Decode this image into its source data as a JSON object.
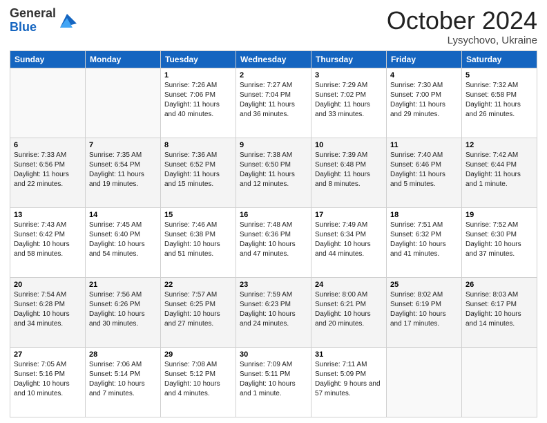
{
  "header": {
    "logo_line1": "General",
    "logo_line2": "Blue",
    "month": "October 2024",
    "location": "Lysychovo, Ukraine"
  },
  "days_of_week": [
    "Sunday",
    "Monday",
    "Tuesday",
    "Wednesday",
    "Thursday",
    "Friday",
    "Saturday"
  ],
  "weeks": [
    [
      {
        "day": "",
        "sunrise": "",
        "sunset": "",
        "daylight": ""
      },
      {
        "day": "",
        "sunrise": "",
        "sunset": "",
        "daylight": ""
      },
      {
        "day": "1",
        "sunrise": "Sunrise: 7:26 AM",
        "sunset": "Sunset: 7:06 PM",
        "daylight": "Daylight: 11 hours and 40 minutes."
      },
      {
        "day": "2",
        "sunrise": "Sunrise: 7:27 AM",
        "sunset": "Sunset: 7:04 PM",
        "daylight": "Daylight: 11 hours and 36 minutes."
      },
      {
        "day": "3",
        "sunrise": "Sunrise: 7:29 AM",
        "sunset": "Sunset: 7:02 PM",
        "daylight": "Daylight: 11 hours and 33 minutes."
      },
      {
        "day": "4",
        "sunrise": "Sunrise: 7:30 AM",
        "sunset": "Sunset: 7:00 PM",
        "daylight": "Daylight: 11 hours and 29 minutes."
      },
      {
        "day": "5",
        "sunrise": "Sunrise: 7:32 AM",
        "sunset": "Sunset: 6:58 PM",
        "daylight": "Daylight: 11 hours and 26 minutes."
      }
    ],
    [
      {
        "day": "6",
        "sunrise": "Sunrise: 7:33 AM",
        "sunset": "Sunset: 6:56 PM",
        "daylight": "Daylight: 11 hours and 22 minutes."
      },
      {
        "day": "7",
        "sunrise": "Sunrise: 7:35 AM",
        "sunset": "Sunset: 6:54 PM",
        "daylight": "Daylight: 11 hours and 19 minutes."
      },
      {
        "day": "8",
        "sunrise": "Sunrise: 7:36 AM",
        "sunset": "Sunset: 6:52 PM",
        "daylight": "Daylight: 11 hours and 15 minutes."
      },
      {
        "day": "9",
        "sunrise": "Sunrise: 7:38 AM",
        "sunset": "Sunset: 6:50 PM",
        "daylight": "Daylight: 11 hours and 12 minutes."
      },
      {
        "day": "10",
        "sunrise": "Sunrise: 7:39 AM",
        "sunset": "Sunset: 6:48 PM",
        "daylight": "Daylight: 11 hours and 8 minutes."
      },
      {
        "day": "11",
        "sunrise": "Sunrise: 7:40 AM",
        "sunset": "Sunset: 6:46 PM",
        "daylight": "Daylight: 11 hours and 5 minutes."
      },
      {
        "day": "12",
        "sunrise": "Sunrise: 7:42 AM",
        "sunset": "Sunset: 6:44 PM",
        "daylight": "Daylight: 11 hours and 1 minute."
      }
    ],
    [
      {
        "day": "13",
        "sunrise": "Sunrise: 7:43 AM",
        "sunset": "Sunset: 6:42 PM",
        "daylight": "Daylight: 10 hours and 58 minutes."
      },
      {
        "day": "14",
        "sunrise": "Sunrise: 7:45 AM",
        "sunset": "Sunset: 6:40 PM",
        "daylight": "Daylight: 10 hours and 54 minutes."
      },
      {
        "day": "15",
        "sunrise": "Sunrise: 7:46 AM",
        "sunset": "Sunset: 6:38 PM",
        "daylight": "Daylight: 10 hours and 51 minutes."
      },
      {
        "day": "16",
        "sunrise": "Sunrise: 7:48 AM",
        "sunset": "Sunset: 6:36 PM",
        "daylight": "Daylight: 10 hours and 47 minutes."
      },
      {
        "day": "17",
        "sunrise": "Sunrise: 7:49 AM",
        "sunset": "Sunset: 6:34 PM",
        "daylight": "Daylight: 10 hours and 44 minutes."
      },
      {
        "day": "18",
        "sunrise": "Sunrise: 7:51 AM",
        "sunset": "Sunset: 6:32 PM",
        "daylight": "Daylight: 10 hours and 41 minutes."
      },
      {
        "day": "19",
        "sunrise": "Sunrise: 7:52 AM",
        "sunset": "Sunset: 6:30 PM",
        "daylight": "Daylight: 10 hours and 37 minutes."
      }
    ],
    [
      {
        "day": "20",
        "sunrise": "Sunrise: 7:54 AM",
        "sunset": "Sunset: 6:28 PM",
        "daylight": "Daylight: 10 hours and 34 minutes."
      },
      {
        "day": "21",
        "sunrise": "Sunrise: 7:56 AM",
        "sunset": "Sunset: 6:26 PM",
        "daylight": "Daylight: 10 hours and 30 minutes."
      },
      {
        "day": "22",
        "sunrise": "Sunrise: 7:57 AM",
        "sunset": "Sunset: 6:25 PM",
        "daylight": "Daylight: 10 hours and 27 minutes."
      },
      {
        "day": "23",
        "sunrise": "Sunrise: 7:59 AM",
        "sunset": "Sunset: 6:23 PM",
        "daylight": "Daylight: 10 hours and 24 minutes."
      },
      {
        "day": "24",
        "sunrise": "Sunrise: 8:00 AM",
        "sunset": "Sunset: 6:21 PM",
        "daylight": "Daylight: 10 hours and 20 minutes."
      },
      {
        "day": "25",
        "sunrise": "Sunrise: 8:02 AM",
        "sunset": "Sunset: 6:19 PM",
        "daylight": "Daylight: 10 hours and 17 minutes."
      },
      {
        "day": "26",
        "sunrise": "Sunrise: 8:03 AM",
        "sunset": "Sunset: 6:17 PM",
        "daylight": "Daylight: 10 hours and 14 minutes."
      }
    ],
    [
      {
        "day": "27",
        "sunrise": "Sunrise: 7:05 AM",
        "sunset": "Sunset: 5:16 PM",
        "daylight": "Daylight: 10 hours and 10 minutes."
      },
      {
        "day": "28",
        "sunrise": "Sunrise: 7:06 AM",
        "sunset": "Sunset: 5:14 PM",
        "daylight": "Daylight: 10 hours and 7 minutes."
      },
      {
        "day": "29",
        "sunrise": "Sunrise: 7:08 AM",
        "sunset": "Sunset: 5:12 PM",
        "daylight": "Daylight: 10 hours and 4 minutes."
      },
      {
        "day": "30",
        "sunrise": "Sunrise: 7:09 AM",
        "sunset": "Sunset: 5:11 PM",
        "daylight": "Daylight: 10 hours and 1 minute."
      },
      {
        "day": "31",
        "sunrise": "Sunrise: 7:11 AM",
        "sunset": "Sunset: 5:09 PM",
        "daylight": "Daylight: 9 hours and 57 minutes."
      },
      {
        "day": "",
        "sunrise": "",
        "sunset": "",
        "daylight": ""
      },
      {
        "day": "",
        "sunrise": "",
        "sunset": "",
        "daylight": ""
      }
    ]
  ]
}
